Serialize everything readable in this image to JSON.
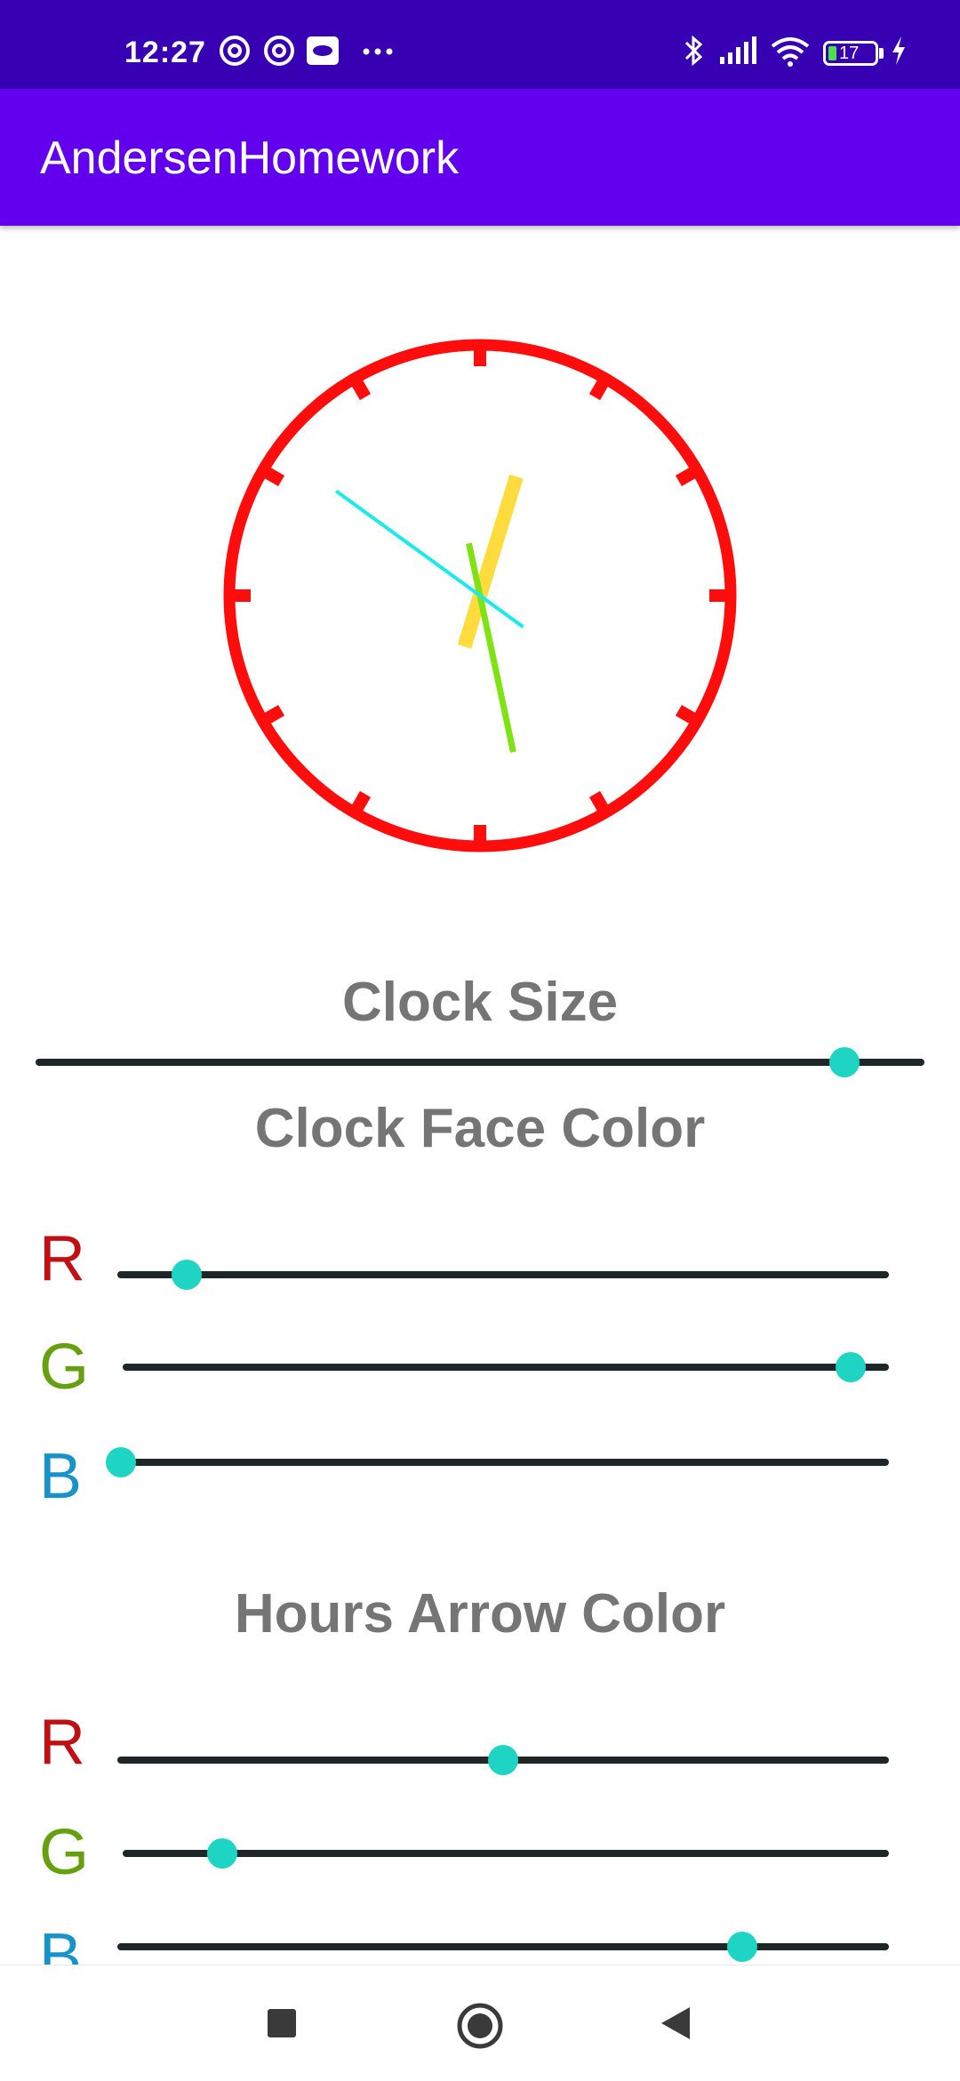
{
  "status_bar": {
    "time": "12:27",
    "battery_level": "17",
    "icons": [
      "at-sign-icon",
      "at-sign-icon",
      "media-icon",
      "more-dots-icon",
      "bluetooth-icon",
      "signal-icon",
      "wifi-icon",
      "battery-icon",
      "charging-icon"
    ]
  },
  "app_bar": {
    "title": "AndersenHomework"
  },
  "clock": {
    "face_color": "#ff0d0d",
    "hour_hand_color": "#fedc3d",
    "minute_hand_color": "#7fe212",
    "second_hand_color": "#1de9ec",
    "hour_hand_angle_deg": 17,
    "minute_hand_angle_deg": 168,
    "second_hand_angle_deg": 306
  },
  "clock_size": {
    "title": "Clock Size",
    "value": 0.91
  },
  "face_color": {
    "title": "Clock Face Color",
    "r_label": "R",
    "r_value": 0.09,
    "g_label": "G",
    "g_value": 0.95,
    "b_label": "B",
    "b_value": 0.0
  },
  "hours_color": {
    "title": "Hours Arrow Color",
    "r_label": "R",
    "r_value": 0.5,
    "g_label": "G",
    "g_value": 0.13,
    "b_label": "B",
    "b_value": 0.81
  },
  "nav_bar": {
    "icons": [
      "recents-square-icon",
      "home-circle-icon",
      "back-triangle-icon"
    ]
  },
  "colors": {
    "status_bar": "#3700b3",
    "app_bar": "#6200ee",
    "slider_thumb": "#1ed4c3",
    "title_text": "#757575"
  }
}
